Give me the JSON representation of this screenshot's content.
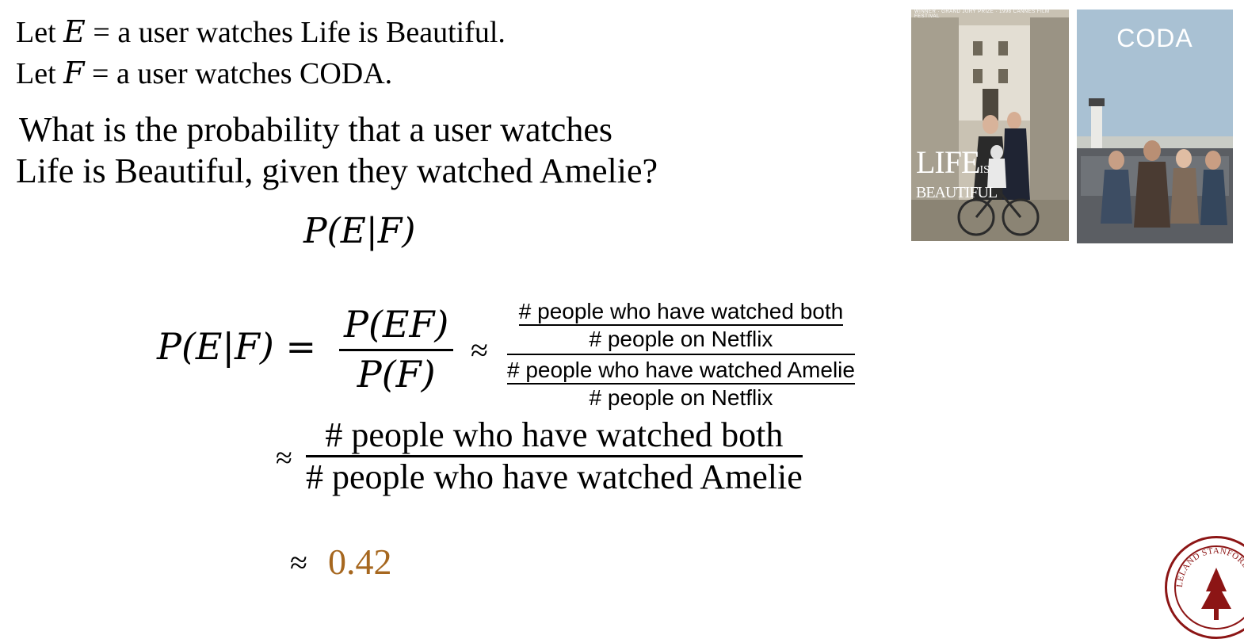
{
  "definitions": {
    "e": {
      "prefix": "Let ",
      "var": "E",
      "rest": " = a user watches Life is Beautiful."
    },
    "f": {
      "prefix": "Let ",
      "var": "F",
      "rest": " = a user watches CODA."
    }
  },
  "question": {
    "line1": "What is the probability that a user watches",
    "line2": "Life is Beautiful, given they watched Amelie?"
  },
  "conditional_top": "P(E|F)",
  "equation": {
    "lhs": "P(E|F) =",
    "numerator": "P(EF)",
    "denominator": "P(F)",
    "approx": "≈",
    "nested": {
      "top_num": "# people who have watched both",
      "top_den": "# people on Netflix",
      "bottom_num": "# people who have watched Amelie",
      "bottom_den": "# people on Netflix"
    },
    "second_approx": "≈",
    "second_num": "# people who have watched both",
    "second_den": "# people who have watched Amelie",
    "result_approx": "≈",
    "result": "0.42"
  },
  "colors": {
    "result": "#a6671f",
    "seal": "#8c1515"
  },
  "posters": {
    "life": {
      "banner": "WINNER · GRAND JURY PRIZE · 1998 CANNES FILM FESTIVAL",
      "title": "LIFE",
      "title_is": "IS",
      "title_sub": "BEAUTIFUL"
    },
    "coda": {
      "title": "CODA"
    }
  },
  "seal": {
    "text": "LELAND STANFORD JUNIOR"
  }
}
